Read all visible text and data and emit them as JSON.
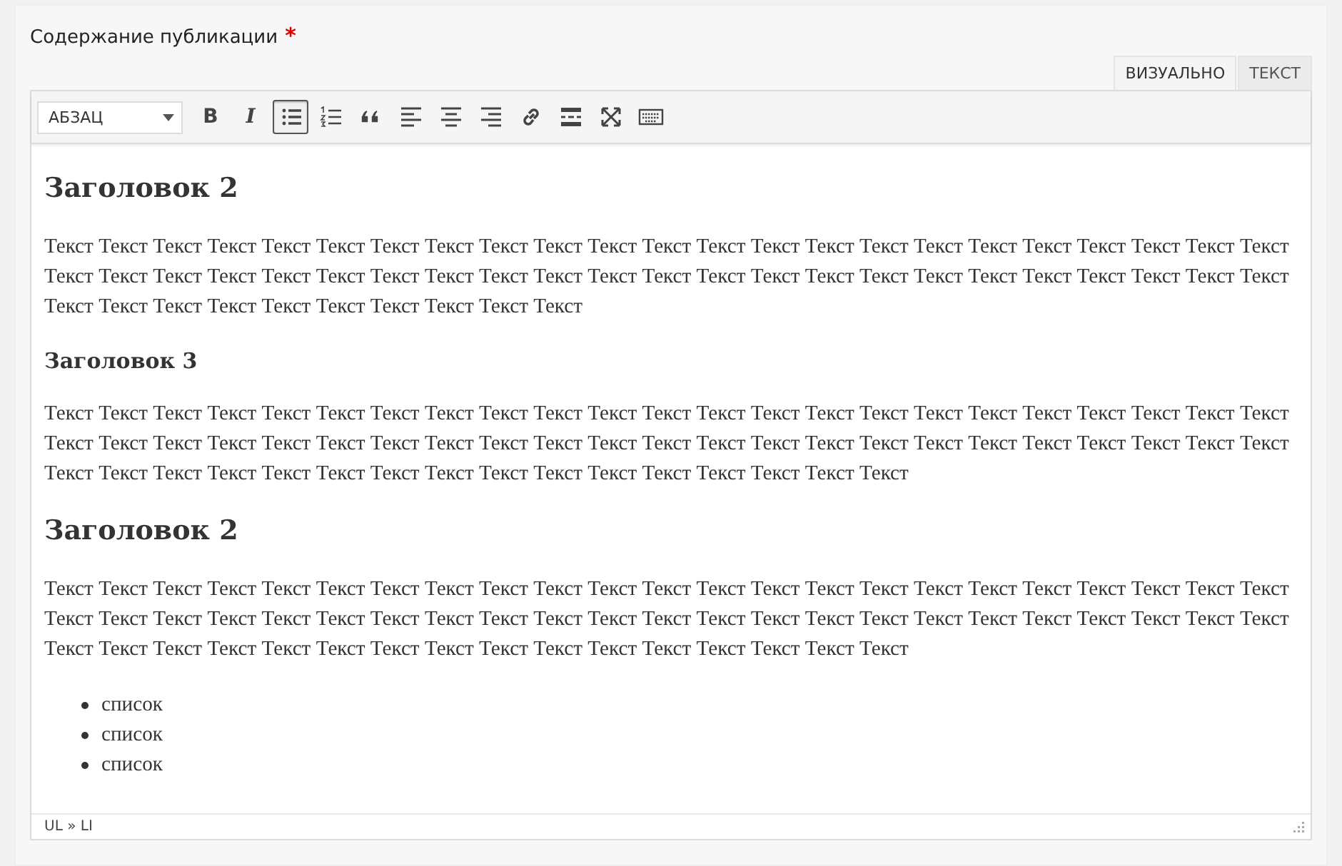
{
  "field_label": {
    "text": "Содержание публикации",
    "required_mark": "*"
  },
  "tabs": [
    {
      "label": "ВИЗУАЛЬНО",
      "selected": true
    },
    {
      "label": "ТЕКСТ",
      "selected": false
    }
  ],
  "toolbar": {
    "format_select": "АБЗАЦ",
    "buttons": [
      {
        "kind": "bold",
        "label": "B",
        "selected": false
      },
      {
        "kind": "italic",
        "label": "I",
        "selected": false
      },
      {
        "kind": "bullet-list",
        "selected": true
      },
      {
        "kind": "numbered-list",
        "selected": false
      },
      {
        "kind": "quote",
        "selected": false
      },
      {
        "kind": "align-left",
        "selected": false
      },
      {
        "kind": "align-center",
        "selected": false
      },
      {
        "kind": "align-right",
        "selected": false
      },
      {
        "kind": "link",
        "selected": false
      },
      {
        "kind": "read-more",
        "selected": false
      },
      {
        "kind": "fullscreen",
        "selected": false
      },
      {
        "kind": "keyboard",
        "selected": false
      }
    ]
  },
  "content": [
    {
      "kind": "h2",
      "text": "Заголовок 2"
    },
    {
      "kind": "p",
      "text": "Текст Текст Текст Текст Текст Текст Текст Текст Текст Текст Текст Текст Текст Текст Текст Текст Текст Текст Текст Текст Текст Текст Текст Текст Текст Текст Текст Текст Текст Текст Текст Текст Текст Текст Текст Текст Текст Текст Текст Текст Текст Текст Текст Текст Текст Текст Текст Текст Текст Текст Текст Текст Текст Текст Текст Текст"
    },
    {
      "kind": "h3",
      "text": "Заголовок 3"
    },
    {
      "kind": "p",
      "text": "Текст Текст Текст Текст Текст Текст Текст Текст Текст Текст Текст Текст Текст Текст Текст Текст Текст Текст Текст Текст Текст Текст Текст Текст Текст Текст Текст Текст Текст Текст Текст Текст Текст Текст Текст Текст Текст Текст Текст Текст Текст Текст Текст Текст Текст Текст Текст Текст Текст Текст Текст Текст Текст Текст Текст Текст Текст Текст Текст Текст Текст Текст"
    },
    {
      "kind": "h2",
      "text": "Заголовок 2"
    },
    {
      "kind": "p",
      "text": "Текст Текст Текст Текст Текст Текст Текст Текст Текст Текст Текст Текст Текст Текст Текст Текст Текст Текст Текст Текст Текст Текст Текст Текст Текст Текст Текст Текст Текст Текст Текст Текст Текст Текст Текст Текст Текст Текст Текст Текст Текст Текст Текст Текст Текст Текст Текст Текст Текст Текст Текст Текст Текст Текст Текст Текст Текст Текст Текст Текст Текст Текст"
    },
    {
      "kind": "ul",
      "items": [
        "список",
        "список",
        "список"
      ]
    }
  ],
  "status_bar": {
    "path": "UL » LI"
  }
}
